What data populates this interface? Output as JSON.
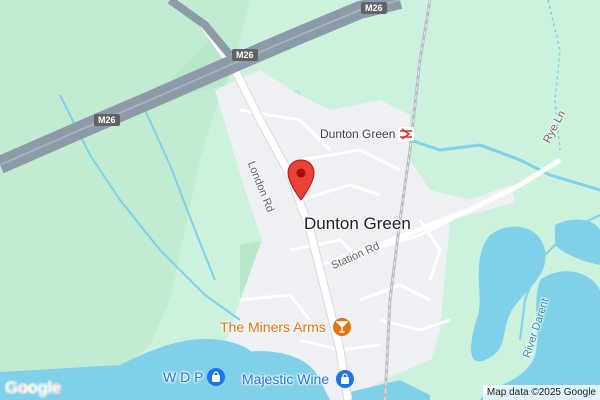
{
  "map": {
    "places": {
      "town": "Dunton Green",
      "station": "Dunton Green"
    },
    "roads": {
      "london_rd": "London Rd",
      "station_rd": "Station Rd",
      "rye_ln": "Rye Ln",
      "river": "River Darent"
    },
    "motorway": {
      "shield_top": "M26",
      "shield_mid": "M26",
      "shield_left": "M26"
    },
    "pois": [
      {
        "name": "The Miners Arms",
        "icon": "cocktail-icon",
        "color": "#e8710a"
      },
      {
        "name": "W D P",
        "icon": "shopping-bag-icon",
        "color": "#1a73e8"
      },
      {
        "name": "Majestic Wine",
        "icon": "shopping-bag-icon",
        "color": "#1a73e8"
      }
    ],
    "marker": {
      "icon": "map-pin-icon",
      "color": "#ea4335"
    },
    "branding": {
      "logo": "Google",
      "attribution": "Map data ©2025 Google"
    },
    "colors": {
      "land": "#ccf2dd",
      "park": "#b7e8c8",
      "urban": "#eef0f3",
      "water": "#7fd0e8",
      "motorway": "#8d9aa7",
      "road": "#ffffff"
    }
  }
}
